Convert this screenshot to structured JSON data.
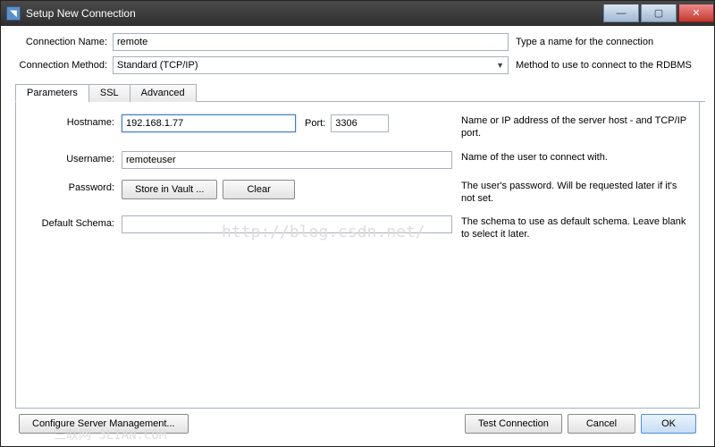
{
  "window": {
    "title": "Setup New Connection"
  },
  "winbtns": {
    "min": "—",
    "max": "▢",
    "close": "✕"
  },
  "fields": {
    "connName": {
      "label": "Connection Name:",
      "value": "remote",
      "help": "Type a name for the connection"
    },
    "connMethod": {
      "label": "Connection Method:",
      "value": "Standard (TCP/IP)",
      "help": "Method to use to connect to the RDBMS"
    }
  },
  "tabs": {
    "parameters": "Parameters",
    "ssl": "SSL",
    "advanced": "Advanced"
  },
  "params": {
    "hostname": {
      "label": "Hostname:",
      "value": "192.168.1.77",
      "portLabel": "Port:",
      "port": "3306",
      "help": "Name or IP address of the server host - and TCP/IP port."
    },
    "username": {
      "label": "Username:",
      "value": "remoteuser",
      "help": "Name of the user to connect with."
    },
    "password": {
      "label": "Password:",
      "storeBtn": "Store in Vault ...",
      "clearBtn": "Clear",
      "help": "The user's password. Will be requested later if it's not set."
    },
    "schema": {
      "label": "Default Schema:",
      "value": "",
      "help": "The schema to use as default schema. Leave blank to select it later."
    }
  },
  "footer": {
    "configure": "Configure Server Management...",
    "test": "Test Connection",
    "cancel": "Cancel",
    "ok": "OK"
  },
  "watermark1": "http://blog.csdn.net/",
  "watermark2": "三联网 3LIAN.COM"
}
